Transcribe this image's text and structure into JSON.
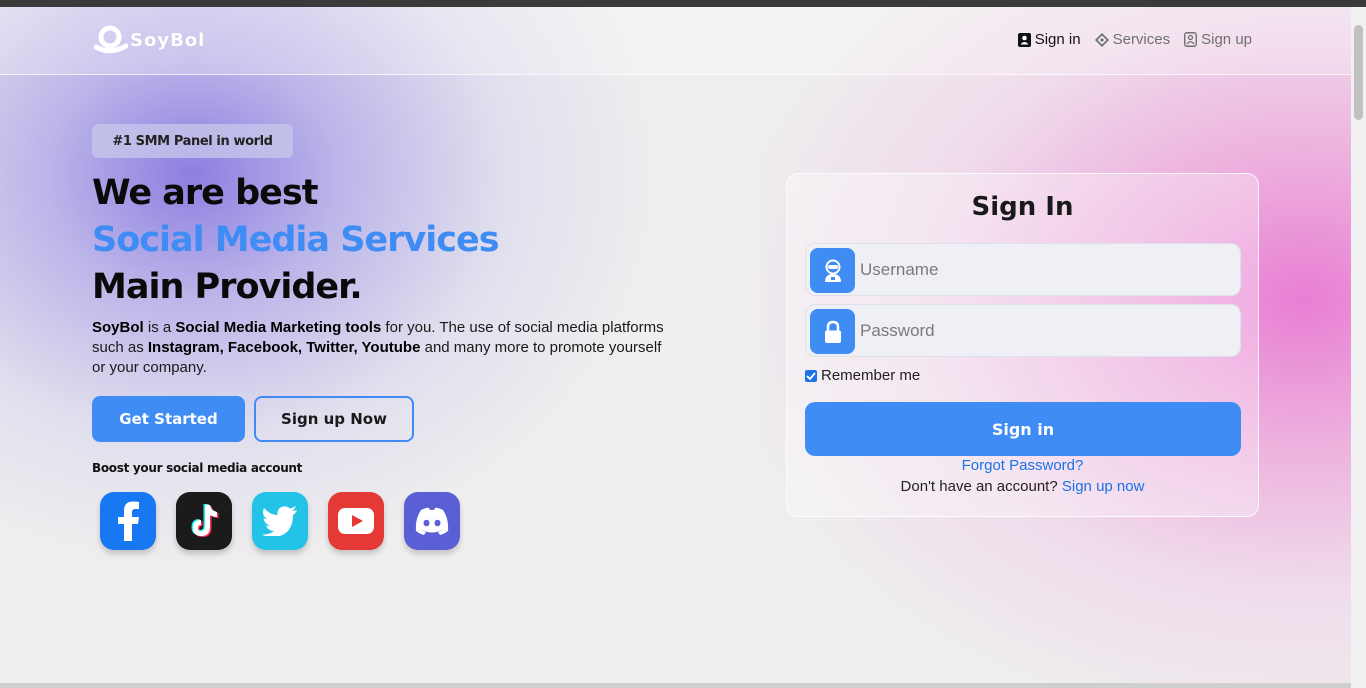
{
  "brand": {
    "name": "SoyBol"
  },
  "nav": {
    "items": [
      {
        "label": "Sign in",
        "icon": "user-badge-icon",
        "active": true
      },
      {
        "label": "Services",
        "icon": "diamond-icon",
        "active": false
      },
      {
        "label": "Sign up",
        "icon": "user-plus-icon",
        "active": false
      }
    ]
  },
  "hero": {
    "badge": "#1 SMM Panel in world",
    "title_line1": "We are best",
    "title_line2": "Social Media Services",
    "title_line3": "Main Provider.",
    "desc": {
      "brand": "SoyBol",
      "t1": " is a ",
      "b1": "Social Media Marketing tools",
      "t2": " for you. The use of social media platforms such as ",
      "b2": "Instagram, Facebook, Twitter, Youtube",
      "t3": " and many more to promote yourself or your company."
    },
    "primary_button": "Get Started",
    "secondary_button": "Sign up Now",
    "boost_label": "Boost your social media account",
    "socials": [
      "facebook-icon",
      "tiktok-icon",
      "twitter-icon",
      "youtube-icon",
      "discord-icon"
    ]
  },
  "signin": {
    "title": "Sign In",
    "username_placeholder": "Username",
    "password_placeholder": "Password",
    "remember_label": "Remember me",
    "remember_checked": true,
    "submit_label": "Sign in",
    "forgot_label": "Forgot Password?",
    "no_account_text": "Don't have an account?",
    "signup_link": "Sign up now"
  },
  "colors": {
    "accent": "#3f8cf5",
    "link": "#1a73e8"
  }
}
